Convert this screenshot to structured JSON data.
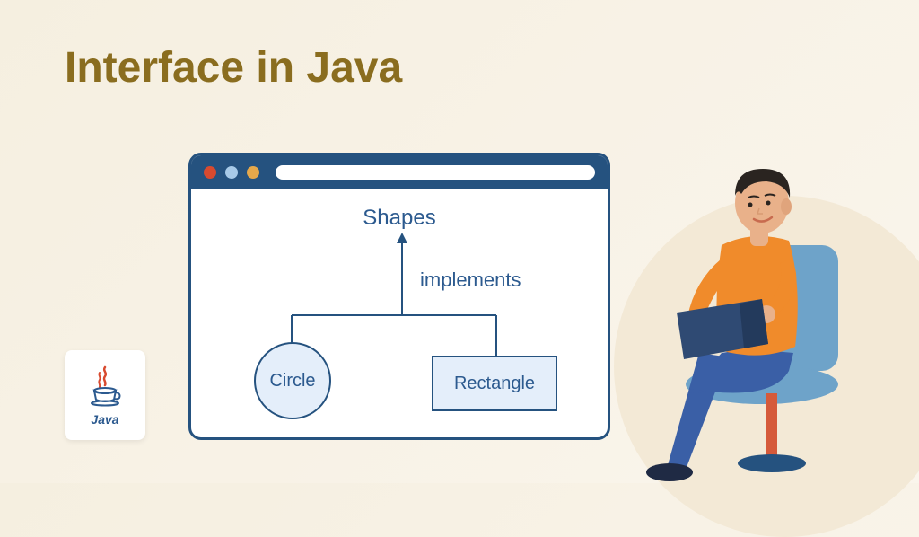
{
  "title": "Interface in Java",
  "java_badge": {
    "label": "Java"
  },
  "diagram": {
    "interface_name": "Shapes",
    "relation_label": "implements",
    "nodes": {
      "circle": "Circle",
      "rectangle": "Rectangle"
    }
  },
  "icons": {
    "window_dots": [
      "red",
      "blue",
      "yellow"
    ]
  },
  "colors": {
    "title": "#8a6d1f",
    "window_border": "#25527f",
    "node_fill": "#e4eefa",
    "text": "#2c5a8f",
    "person_shirt": "#f08b2b",
    "person_pants": "#3a5fa6",
    "chair": "#6ea3c9"
  }
}
